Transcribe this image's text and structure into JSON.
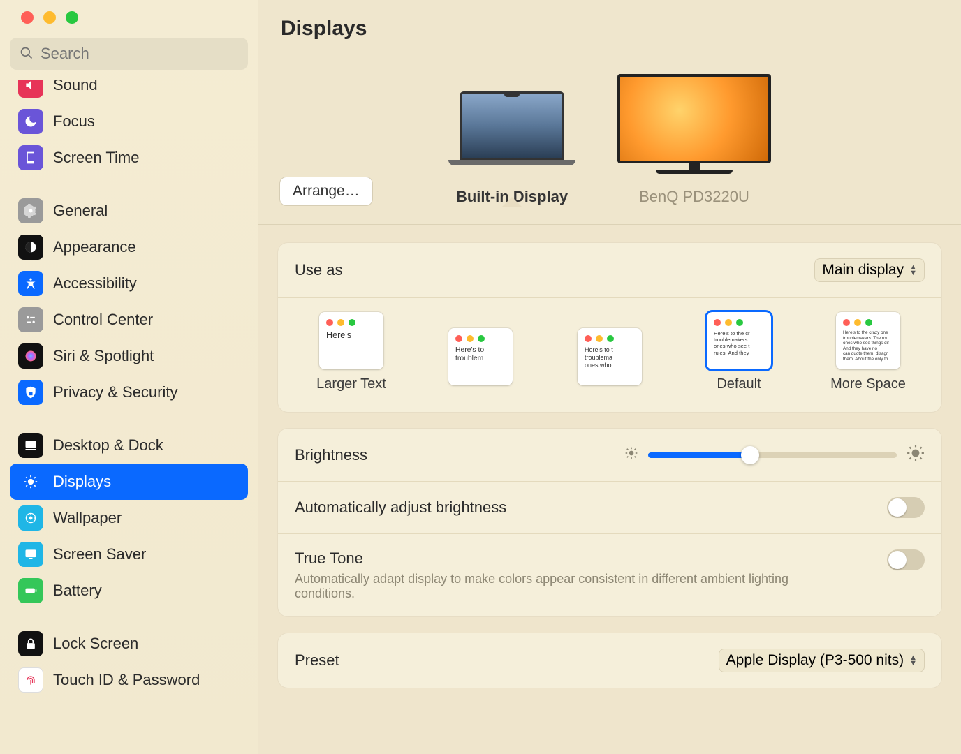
{
  "search": {
    "placeholder": "Search"
  },
  "header": {
    "title": "Displays"
  },
  "sidebar": {
    "items": [
      {
        "label": "Sound",
        "icon": "sound"
      },
      {
        "label": "Focus",
        "icon": "focus"
      },
      {
        "label": "Screen Time",
        "icon": "screentime"
      },
      {
        "label": "General",
        "icon": "general"
      },
      {
        "label": "Appearance",
        "icon": "appearance"
      },
      {
        "label": "Accessibility",
        "icon": "accessibility"
      },
      {
        "label": "Control Center",
        "icon": "controlcenter"
      },
      {
        "label": "Siri & Spotlight",
        "icon": "siri"
      },
      {
        "label": "Privacy & Security",
        "icon": "privacy"
      },
      {
        "label": "Desktop & Dock",
        "icon": "desktop"
      },
      {
        "label": "Displays",
        "icon": "displays",
        "selected": true
      },
      {
        "label": "Wallpaper",
        "icon": "wallpaper"
      },
      {
        "label": "Screen Saver",
        "icon": "screensaver"
      },
      {
        "label": "Battery",
        "icon": "battery"
      },
      {
        "label": "Lock Screen",
        "icon": "lock"
      },
      {
        "label": "Touch ID & Password",
        "icon": "touchid"
      }
    ]
  },
  "picker": {
    "arrange": "Arrange…",
    "builtin": "Built-in Display",
    "external": "BenQ PD3220U",
    "active": "builtin"
  },
  "useas": {
    "label": "Use as",
    "value": "Main display"
  },
  "resolution": {
    "options": [
      {
        "caption": "Larger Text",
        "sample": "Here's"
      },
      {
        "caption": "",
        "sample": "Here's to troublem"
      },
      {
        "caption": "",
        "sample": "Here's to t\ntroublema\nones who"
      },
      {
        "caption": "Default",
        "sample": "Here's to the cr\ntroublemakers.\nones who see t\nrules. And they",
        "selected": true
      },
      {
        "caption": "More Space",
        "sample": "Here's to the crazy one\ntroublemakers. The rou\nones who see things dif\nAnd they have no\ncan quote them, disagr\nthem. About the only th\nBecause they change th"
      }
    ]
  },
  "brightness": {
    "label": "Brightness",
    "percent": 41
  },
  "autoBrightness": {
    "label": "Automatically adjust brightness",
    "on": false
  },
  "trueTone": {
    "label": "True Tone",
    "desc": "Automatically adapt display to make colors appear consistent in different ambient lighting conditions.",
    "on": false
  },
  "preset": {
    "label": "Preset",
    "value": "Apple Display (P3-500 nits)"
  }
}
